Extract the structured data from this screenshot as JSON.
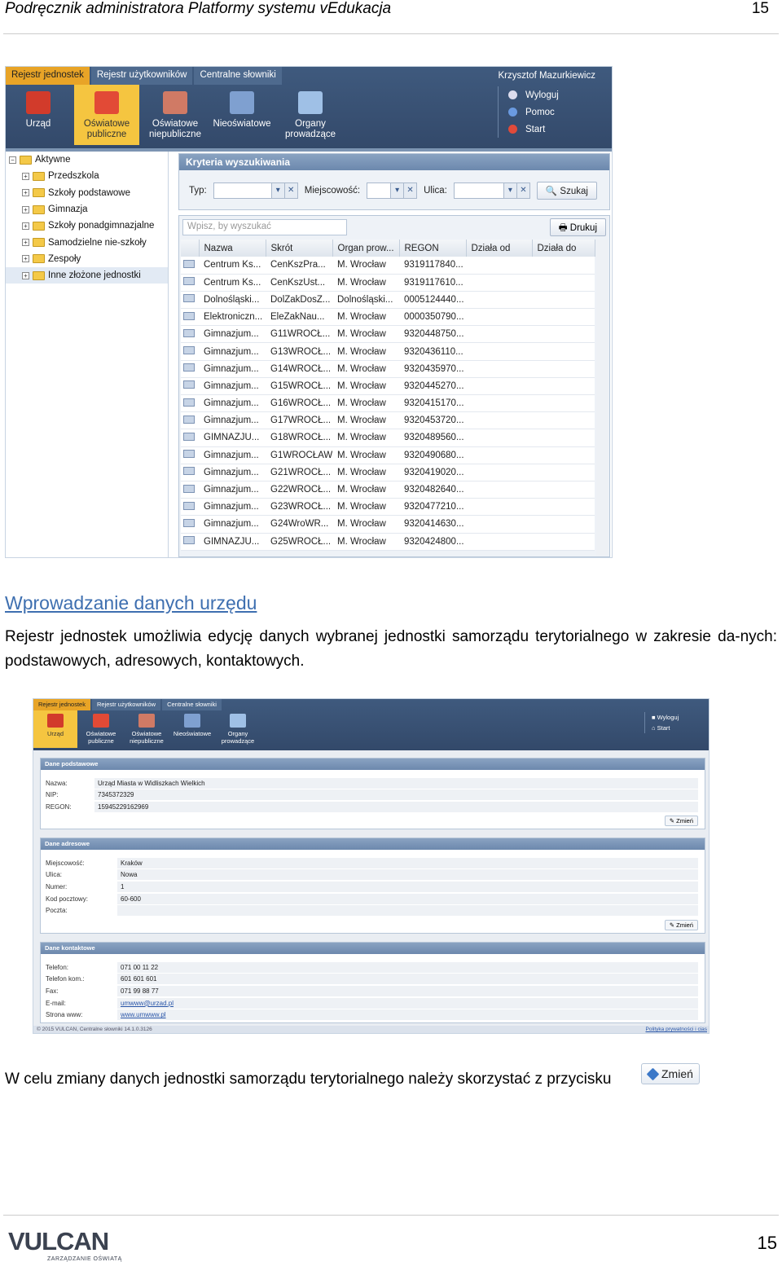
{
  "header": {
    "title": "Podręcznik administratora Platformy systemu vEdukacja",
    "page_number": "15"
  },
  "screenshot1": {
    "tabs": [
      "Rejestr jednostek",
      "Rejestr użytkowników",
      "Centralne słowniki"
    ],
    "user": "Krzysztof Mazurkiewicz",
    "tools": [
      {
        "label": "Urząd",
        "icon": "city-hall-icon"
      },
      {
        "label": "Oświatowe publiczne",
        "icon": "public-school-icon"
      },
      {
        "label": "Oświatowe niepubliczne",
        "icon": "private-school-icon"
      },
      {
        "label": "Nieoświatowe",
        "icon": "non-education-icon"
      },
      {
        "label": "Organy prowadzące",
        "icon": "governing-body-icon"
      }
    ],
    "links": [
      {
        "label": "Wyloguj",
        "icon": "lock-icon"
      },
      {
        "label": "Pomoc",
        "icon": "info-icon"
      },
      {
        "label": "Start",
        "icon": "home-icon"
      }
    ],
    "tree": {
      "root": "Aktywne",
      "items": [
        "Przedszkola",
        "Szkoły podstawowe",
        "Gimnazja",
        "Szkoły ponadgimnazjalne",
        "Samodzielne nie-szkoły",
        "Zespoły",
        "Inne złożone jednostki"
      ]
    },
    "criteria": {
      "title": "Kryteria wyszukiwania",
      "typ": "Typ:",
      "miejscowosc": "Miejscowość:",
      "ulica": "Ulica:",
      "search": "Szukaj"
    },
    "grid": {
      "search_placeholder": "Wpisz, by wyszukać",
      "print": "Drukuj",
      "columns": [
        "Nazwa",
        "Skrót",
        "Organ prow...",
        "REGON",
        "Działa od",
        "Działa do"
      ],
      "rows": [
        [
          "Centrum Ks...",
          "CenKszPra...",
          "M. Wrocław",
          "9319117840...",
          "",
          ""
        ],
        [
          "Centrum Ks...",
          "CenKszUst...",
          "M. Wrocław",
          "9319117610...",
          "",
          ""
        ],
        [
          "Dolnośląski...",
          "DolZakDosZ...",
          "Dolnośląski...",
          "0005124440...",
          "",
          ""
        ],
        [
          "Elektroniczn...",
          "EleZakNau...",
          "M. Wrocław",
          "0000350790...",
          "",
          ""
        ],
        [
          "Gimnazjum...",
          "G11WROCŁ...",
          "M. Wrocław",
          "9320448750...",
          "",
          ""
        ],
        [
          "Gimnazjum...",
          "G13WROCŁ...",
          "M. Wrocław",
          "9320436110...",
          "",
          ""
        ],
        [
          "Gimnazjum...",
          "G14WROCŁ...",
          "M. Wrocław",
          "9320435970...",
          "",
          ""
        ],
        [
          "Gimnazjum...",
          "G15WROCŁ...",
          "M. Wrocław",
          "9320445270...",
          "",
          ""
        ],
        [
          "Gimnazjum...",
          "G16WROCŁ...",
          "M. Wrocław",
          "9320415170...",
          "",
          ""
        ],
        [
          "Gimnazjum...",
          "G17WROCŁ...",
          "M. Wrocław",
          "9320453720...",
          "",
          ""
        ],
        [
          "GIMNAZJU...",
          "G18WROCŁ...",
          "M. Wrocław",
          "9320489560...",
          "",
          ""
        ],
        [
          "Gimnazjum...",
          "G1WROCŁAW",
          "M. Wrocław",
          "9320490680...",
          "",
          ""
        ],
        [
          "Gimnazjum...",
          "G21WROCŁ...",
          "M. Wrocław",
          "9320419020...",
          "",
          ""
        ],
        [
          "Gimnazjum...",
          "G22WROCŁ...",
          "M. Wrocław",
          "9320482640...",
          "",
          ""
        ],
        [
          "Gimnazjum...",
          "G23WROCŁ...",
          "M. Wrocław",
          "9320477210...",
          "",
          ""
        ],
        [
          "Gimnazjum...",
          "G24WroWR...",
          "M. Wrocław",
          "9320414630...",
          "",
          ""
        ],
        [
          "GIMNAZJU...",
          "G25WROCŁ...",
          "M. Wrocław",
          "9320424800...",
          "",
          ""
        ]
      ]
    }
  },
  "section": {
    "heading": "Wprowadzanie danych urzędu",
    "paragraph": "Rejestr  jednostek umożliwia edycję danych wybranej jednostki samorządu terytorialnego w zakresie da-nych: podstawowych, adresowych, kontaktowych."
  },
  "screenshot2": {
    "tabs": [
      "Rejestr jednostek",
      "Rejestr użytkowników",
      "Centralne słowniki"
    ],
    "tools": [
      {
        "label": "Urząd",
        "icon": "city-hall-icon"
      },
      {
        "label": "Oświatowe publiczne",
        "icon": "public-school-icon"
      },
      {
        "label": "Oświatowe niepubliczne",
        "icon": "private-school-icon"
      },
      {
        "label": "Nieoświatowe",
        "icon": "non-education-icon"
      },
      {
        "label": "Organy prowadzące",
        "icon": "governing-body-icon"
      }
    ],
    "links": [
      "Wyloguj",
      "Start"
    ],
    "basic": {
      "title": "Dane podstawowe",
      "fields": [
        [
          "Nazwa:",
          "Urząd Miasta w Widliszkach Wielkich"
        ],
        [
          "NIP:",
          "7345372329"
        ],
        [
          "REGON:",
          "15945229162969"
        ]
      ]
    },
    "address": {
      "title": "Dane adresowe",
      "fields": [
        [
          "Miejscowość:",
          "Kraków"
        ],
        [
          "Ulica:",
          "Nowa"
        ],
        [
          "Numer:",
          "1"
        ],
        [
          "Kod pocztowy:",
          "60-600"
        ],
        [
          "Poczta:",
          ""
        ]
      ]
    },
    "contact": {
      "title": "Dane kontaktowe",
      "fields": [
        [
          "Telefon:",
          "071 00 11 22"
        ],
        [
          "Telefon kom.:",
          "601 601 601"
        ],
        [
          "Fax:",
          "071 99 88 77"
        ],
        [
          "E-mail:",
          "umwww@urzad.pl"
        ],
        [
          "Strona www:",
          "www.umwww.pl"
        ]
      ]
    },
    "edit_label": "Zmień",
    "footer_left": "© 2015 VULCAN, Centralne słowniki 14.1.0.3126",
    "footer_right": "Polityka prywatności i cias"
  },
  "instruction": {
    "text": "W celu zmiany danych jednostki samorządu terytorialnego należy skorzystać z przycisku",
    "button": "Zmień"
  },
  "footer": {
    "logo": "VULCAN",
    "logo_sub": "ZARZĄDZANIE OŚWIATĄ",
    "page_number": "15"
  },
  "colors": {
    "topbar": "#3f5a7e",
    "active_tab": "#e8a427",
    "active_tool": "#f5c540",
    "heading": "#3e6fb0"
  }
}
